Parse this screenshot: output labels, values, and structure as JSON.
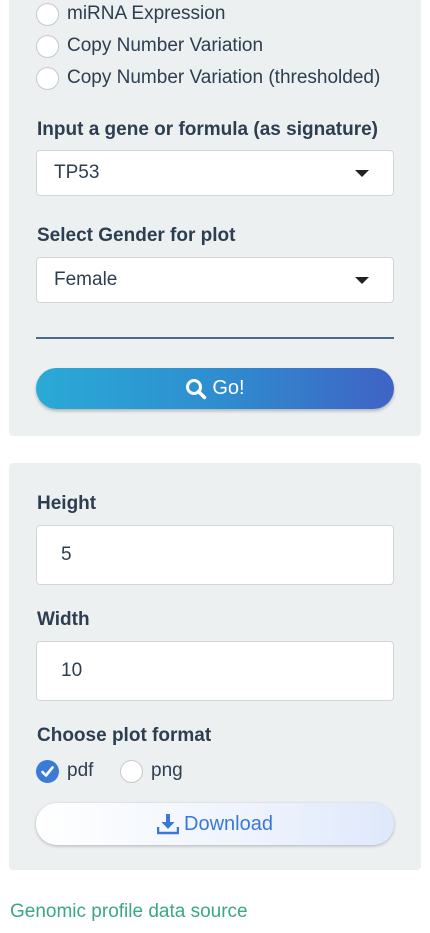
{
  "data_type": {
    "options": [
      {
        "label": "miRNA Expression",
        "selected": false
      },
      {
        "label": "Copy Number Variation",
        "selected": false
      },
      {
        "label": "Copy Number Variation (thresholded)",
        "selected": false
      }
    ]
  },
  "gene_input": {
    "label": "Input a gene or formula (as signature)",
    "value": "TP53"
  },
  "gender_select": {
    "label": "Select Gender for plot",
    "value": "Female"
  },
  "go_button": {
    "label": "Go!",
    "icon": "search-icon"
  },
  "plot_size": {
    "height_label": "Height",
    "height_value": "5",
    "width_label": "Width",
    "width_value": "10"
  },
  "plot_format": {
    "label": "Choose plot format",
    "options": [
      {
        "label": "pdf",
        "checked": true
      },
      {
        "label": "png",
        "checked": false
      }
    ]
  },
  "download_button": {
    "label": "Download",
    "icon": "download-icon"
  },
  "footer": {
    "link_text": "Genomic profile data source"
  },
  "colors": {
    "panel_bg": "#ecf0f1",
    "text": "#2c3e50",
    "accent_blue": "#3a7bd5",
    "link_green": "#3aa786"
  }
}
